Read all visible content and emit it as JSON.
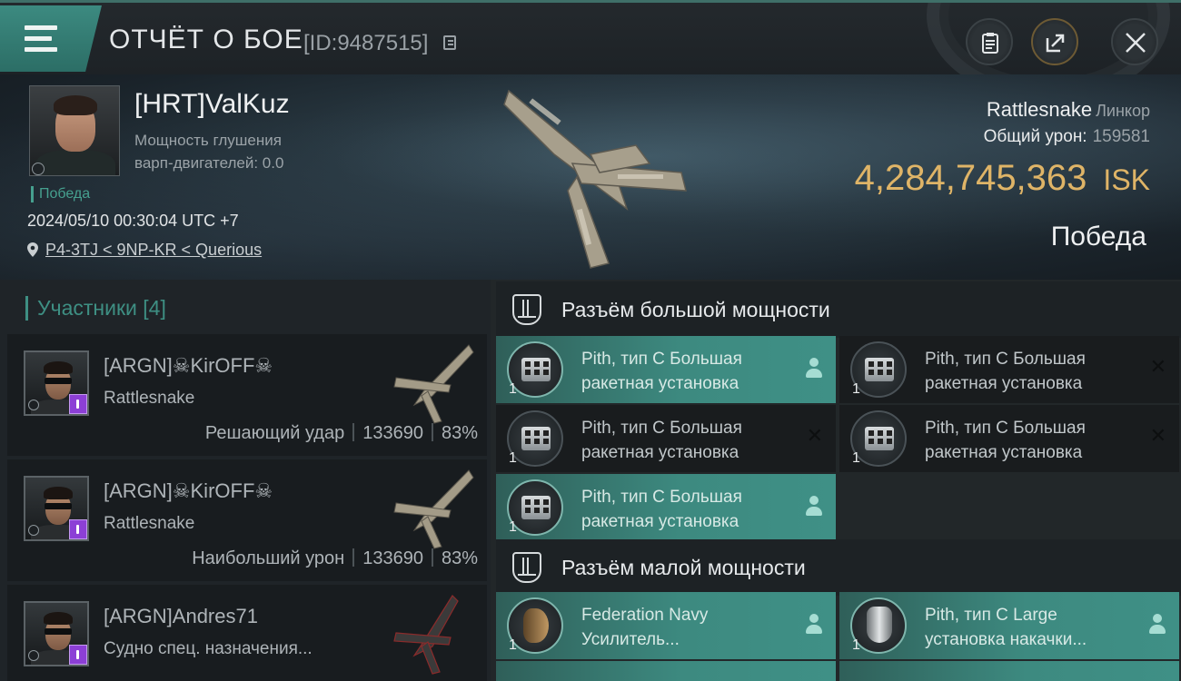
{
  "header": {
    "title": "ОТЧЁТ О БОЕ",
    "id_label": "[ID:9487515]"
  },
  "victim": {
    "pilot_name": "[HRT]ValKuz",
    "stat_line1": "Мощность глушения",
    "stat_line2": "варп-двигателей: 0.0",
    "status_tag": "Победа",
    "datetime": "2024/05/10 00:30:04 UTC +7",
    "location": "P4-3TJ < 9NP-KR < Querious",
    "ship_name": "Rattlesnake",
    "ship_class": "Линкор",
    "total_damage_label": "Общий урон:",
    "total_damage_value": "159581",
    "isk_value": "4,284,745,363",
    "isk_unit": "ISK",
    "result": "Победа"
  },
  "participants": {
    "title": "Участники [4]",
    "items": [
      {
        "name": "[ARGN]☠KirOFF☠",
        "ship": "Rattlesnake",
        "role_label": "Решающий удар",
        "damage": "133690",
        "percent": "83%"
      },
      {
        "name": "[ARGN]☠KirOFF☠",
        "ship": "Rattlesnake",
        "role_label": "Наибольший урон",
        "damage": "133690",
        "percent": "83%"
      },
      {
        "name": "[ARGN]Andres71",
        "ship": "Судно спец. назначения..."
      }
    ]
  },
  "slots": {
    "high": {
      "title": "Разъём большой мощности",
      "modules": [
        {
          "name_line1": "Pith, тип C Большая",
          "name_line2": "ракетная установка",
          "qty": "1",
          "state": "dropped"
        },
        {
          "name_line1": "Pith, тип C Большая",
          "name_line2": "ракетная установка",
          "qty": "1",
          "state": "destroyed"
        },
        {
          "name_line1": "Pith, тип C Большая",
          "name_line2": "ракетная установка",
          "qty": "1",
          "state": "destroyed"
        },
        {
          "name_line1": "Pith, тип C Большая",
          "name_line2": "ракетная установка",
          "qty": "1",
          "state": "destroyed"
        },
        {
          "name_line1": "Pith, тип C Большая",
          "name_line2": "ракетная установка",
          "qty": "1",
          "state": "dropped"
        }
      ]
    },
    "mid": {
      "title": "Разъём малой мощности",
      "modules": [
        {
          "name_line1": "Federation Navy",
          "name_line2": "Усилитель...",
          "qty": "1",
          "state": "dropped"
        },
        {
          "name_line1": "Pith, тип C Large",
          "name_line2": "установка накачки...",
          "qty": "1",
          "state": "dropped"
        }
      ]
    }
  },
  "icons": {
    "dropped": "person-icon",
    "destroyed": "x-icon"
  },
  "colors": {
    "accent_teal": "#3e8f83",
    "isk_gold": "#dfb467",
    "victory_green": "#46a08f",
    "role_purple": "#8c3fd6"
  }
}
